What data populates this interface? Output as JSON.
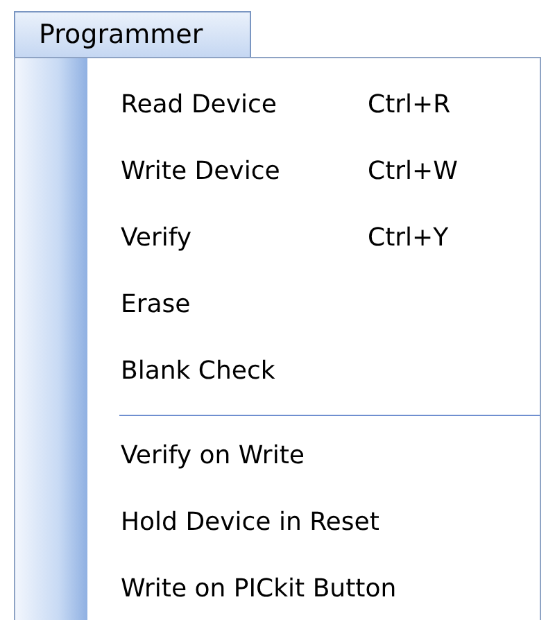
{
  "menu_title": "Programmer",
  "groups": [
    [
      {
        "label": "Read Device",
        "shortcut": "Ctrl+R"
      },
      {
        "label": "Write Device",
        "shortcut": "Ctrl+W"
      },
      {
        "label": "Verify",
        "shortcut": "Ctrl+Y"
      },
      {
        "label": "Erase"
      },
      {
        "label": "Blank Check"
      }
    ],
    [
      {
        "label": "Verify on Write"
      },
      {
        "label": "Hold Device in Reset"
      },
      {
        "label": "Write on PICkit Button"
      }
    ]
  ]
}
